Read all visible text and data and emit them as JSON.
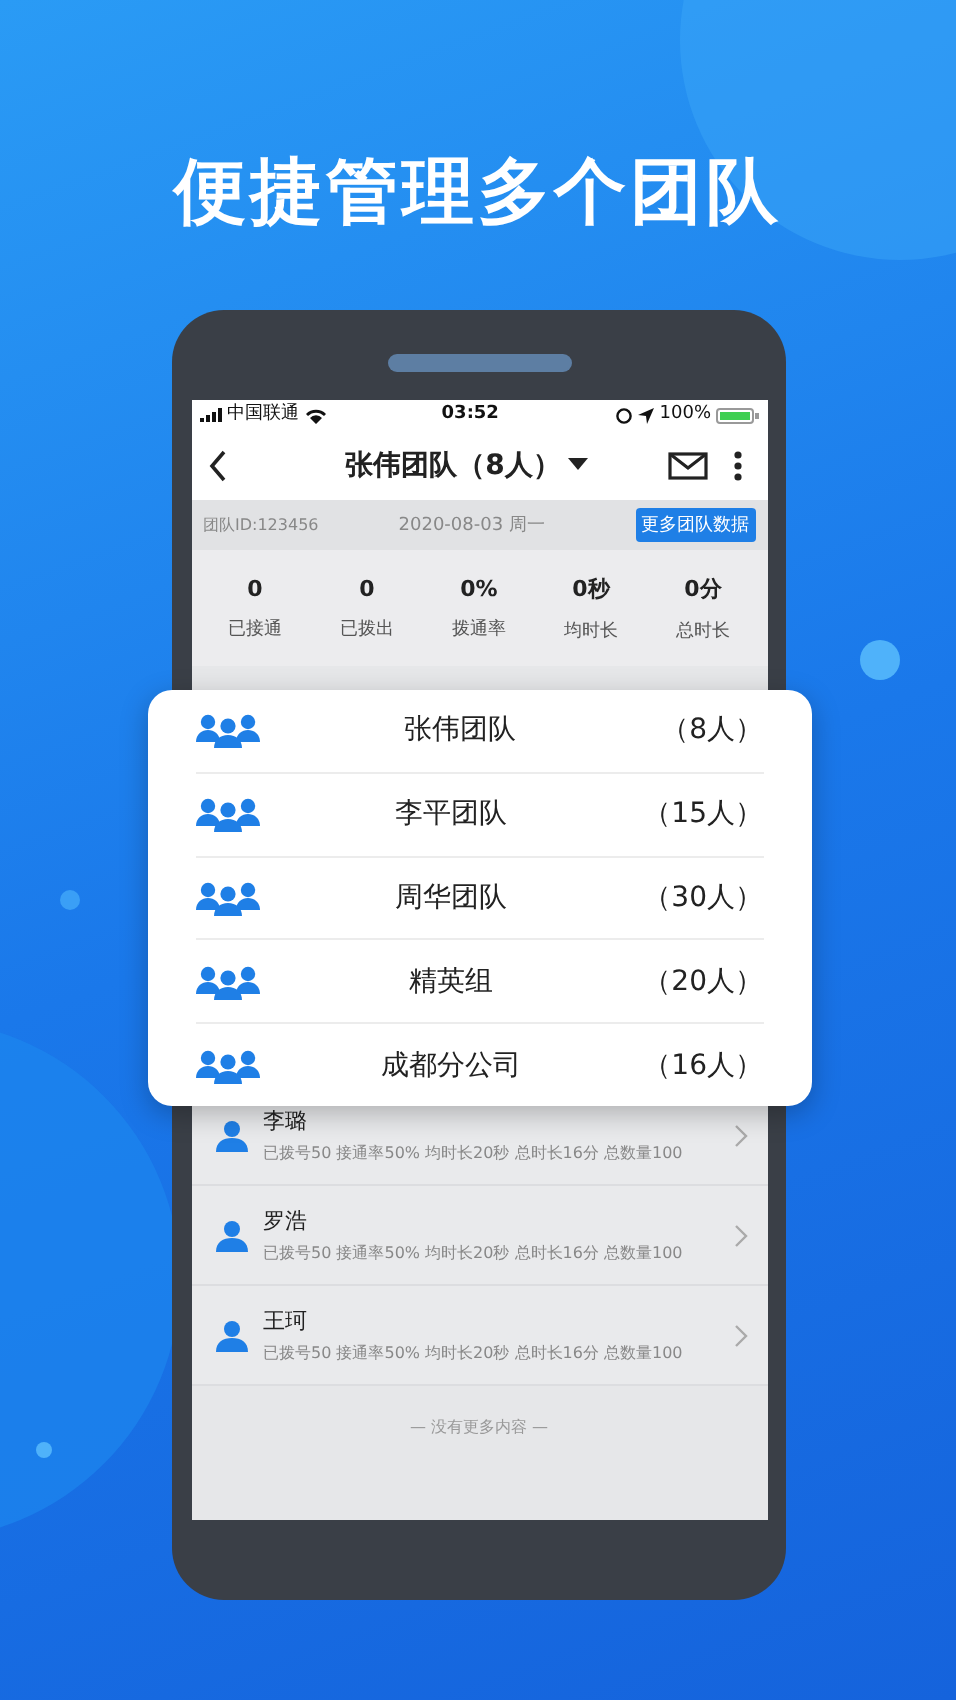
{
  "headline": "便捷管理多个团队",
  "status_bar": {
    "carrier": "中国联通",
    "time": "03:52",
    "battery": "100%"
  },
  "nav": {
    "title": "张伟团队（8人）"
  },
  "info_bar": {
    "team_id": "团队ID:123456",
    "date": "2020-08-03 周一",
    "button": "更多团队数据"
  },
  "stats": [
    {
      "value": "0",
      "label": "已接通"
    },
    {
      "value": "0",
      "label": "已拨出"
    },
    {
      "value": "0%",
      "label": "拨通率"
    },
    {
      "value": "0秒",
      "label": "均时长"
    },
    {
      "value": "0分",
      "label": "总时长"
    }
  ],
  "members": [
    {
      "name": "李璐",
      "detail": "已拨号50 接通率50% 均时长20秒 总时长16分 总数量100"
    },
    {
      "name": "罗浩",
      "detail": "已拨号50 接通率50% 均时长20秒 总时长16分 总数量100"
    },
    {
      "name": "王珂",
      "detail": "已拨号50 接通率50% 均时长20秒 总时长16分 总数量100"
    }
  ],
  "footer": "— 没有更多内容 —",
  "team_menu": [
    {
      "name": "张伟团队",
      "count": "（8人）"
    },
    {
      "name": "李平团队",
      "count": "（15人）"
    },
    {
      "name": "周华团队",
      "count": "（30人）"
    },
    {
      "name": "精英组",
      "count": "（20人）"
    },
    {
      "name": "成都分公司",
      "count": "（16人）"
    }
  ]
}
